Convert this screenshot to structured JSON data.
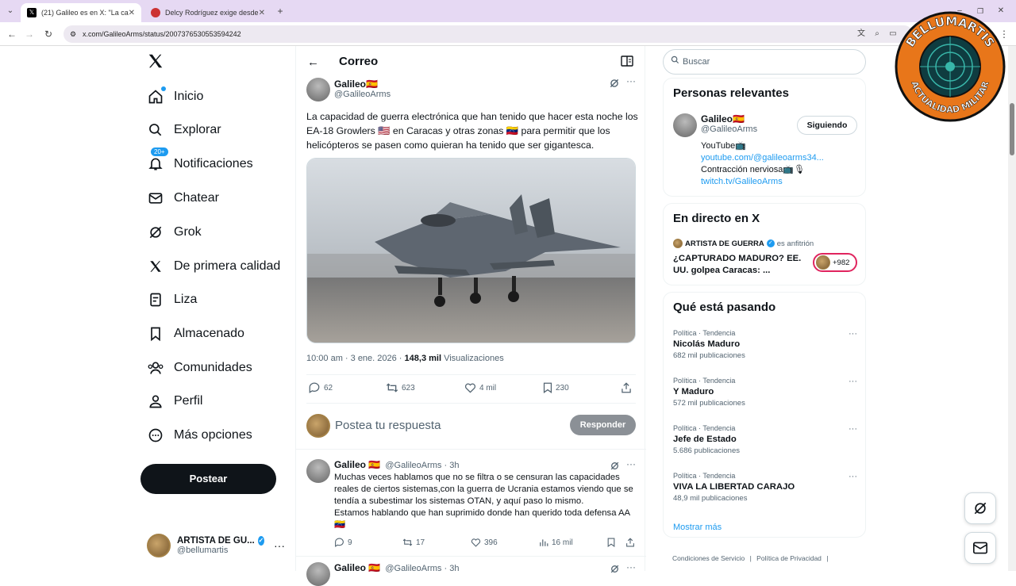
{
  "browser": {
    "tabs": [
      {
        "title": "(21) Galileo es en X: \"La capaci",
        "active": true
      },
      {
        "title": "Delcy Rodríguez exige desde K",
        "active": false
      }
    ],
    "url": "x.com/GalileoArms/status/2007376530553594242"
  },
  "nav": {
    "items": [
      {
        "label": "Inicio",
        "icon": "home-icon"
      },
      {
        "label": "Explorar",
        "icon": "search-icon"
      },
      {
        "label": "Notificaciones",
        "icon": "bell-icon"
      },
      {
        "label": "Chatear",
        "icon": "mail-icon"
      },
      {
        "label": "Grok",
        "icon": "grok-icon"
      },
      {
        "label": "De primera calidad",
        "icon": "x-logo-icon"
      },
      {
        "label": "Liza",
        "icon": "list-icon"
      },
      {
        "label": "Almacenado",
        "icon": "bookmark-icon"
      },
      {
        "label": "Comunidades",
        "icon": "communities-icon"
      },
      {
        "label": "Perfil",
        "icon": "profile-icon"
      },
      {
        "label": "Más opciones",
        "icon": "more-icon"
      }
    ],
    "notif_badge": "20+",
    "post_label": "Postear",
    "account": {
      "name": "ARTISTA DE GU...",
      "handle": "@bellumartis"
    }
  },
  "header": {
    "title": "Correo"
  },
  "tweet": {
    "author": "Galileo🇪🇸",
    "handle": "@GalileoArms",
    "text": "La capacidad de guerra electrónica que han tenido que hacer esta noche los EA-18 Growlers 🇺🇸 en Caracas y otras zonas 🇻🇪 para permitir que los helicópteros se pasen como quieran ha tenido que ser gigantesca.",
    "time": "10:00 am · 3 ene. 2026 · ",
    "views_count": "148,3 mil",
    "views_label": " Visualizaciones",
    "replies": "62",
    "reposts": "623",
    "likes": "4 mil",
    "bookmarks": "230"
  },
  "reply_box": {
    "placeholder": "Postea tu respuesta",
    "button": "Responder"
  },
  "comments": [
    {
      "author": "Galileo 🇪🇸",
      "handle": "@GalileoArms · 3h",
      "text": "Muchas veces hablamos que no se filtra o se censuran las capacidades reales de ciertos sistemas,con la guerra de Ucrania estamos viendo que se tendía a subestimar los sistemas OTAN, y aquí paso lo mismo.",
      "text2": "Estamos hablando que han suprimido donde han querido toda defensa AA 🇻🇪",
      "replies": "9",
      "reposts": "17",
      "likes": "396",
      "views": "16 mil"
    },
    {
      "author": "Galileo 🇪🇸",
      "handle": "@GalileoArms · 3h"
    }
  ],
  "right": {
    "search_placeholder": "Buscar",
    "relevant": {
      "title": "Personas relevantes",
      "name": "Galileo🇪🇸",
      "handle": "@GalileoArms",
      "follow_label": "Siguiendo",
      "bio1": "YouTube📺",
      "bio2": "youtube.com/@galileoarms34...",
      "bio3": "Contracción nerviosa📺🎙",
      "bio4": "twitch.tv/GalileoArms"
    },
    "live": {
      "title": "En directo en X",
      "host": "ARTISTA DE GUERRA",
      "host_suffix": "es anfitrión",
      "text": "¿CAPTURADO MADURO? EE. UU. golpea Caracas: ...",
      "listeners": "+982"
    },
    "trends": {
      "title": "Qué está pasando",
      "items": [
        {
          "category": "Política · Tendencia",
          "name": "Nicolás Maduro",
          "count": "682 mil publicaciones"
        },
        {
          "category": "Política · Tendencia",
          "name": "Y Maduro",
          "count": "572 mil publicaciones"
        },
        {
          "category": "Política · Tendencia",
          "name": "Jefe de Estado",
          "count": "5.686 publicaciones"
        },
        {
          "category": "Política · Tendencia",
          "name": "VIVA LA LIBERTAD CARAJO",
          "count": "48,9 mil publicaciones"
        }
      ],
      "show_more": "Mostrar más"
    },
    "footer": {
      "terms": "Condiciones de Servicio",
      "privacy": "Política de Privacidad"
    }
  },
  "watermark": {
    "top": "BELLUMARTIS",
    "bottom": "ACTUALIDAD MILITAR"
  },
  "colors": {
    "accent": "#1d9bf0",
    "text": "#0f1419",
    "muted": "#536471",
    "tabbar": "#e6d9f3"
  }
}
